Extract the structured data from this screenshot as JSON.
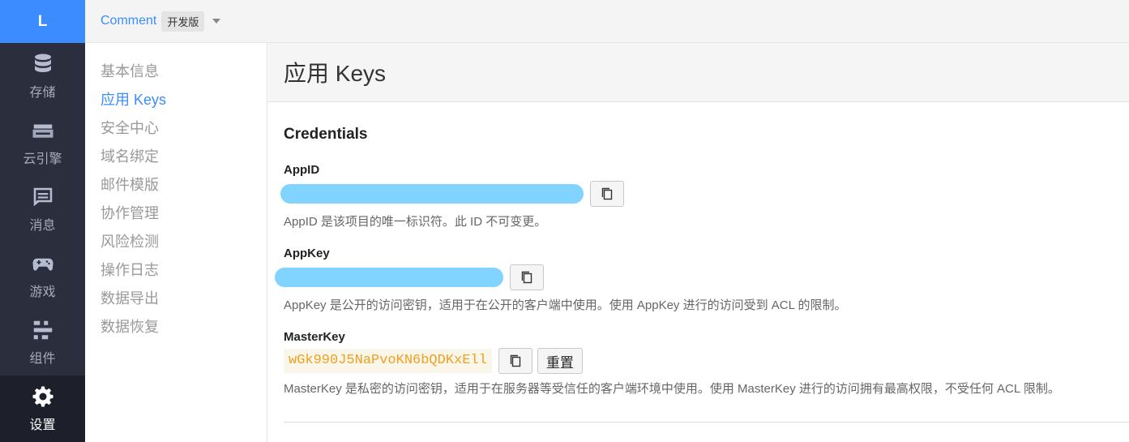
{
  "rail": {
    "logo": "L",
    "items": [
      {
        "label": "存储",
        "icon": "database-icon"
      },
      {
        "label": "云引擎",
        "icon": "cloud-engine-icon"
      },
      {
        "label": "消息",
        "icon": "message-icon"
      },
      {
        "label": "游戏",
        "icon": "gamepad-icon"
      },
      {
        "label": "组件",
        "icon": "components-icon"
      },
      {
        "label": "设置",
        "icon": "gear-icon",
        "active": true
      }
    ]
  },
  "topbar": {
    "app_name": "Comment",
    "env_badge": "开发版"
  },
  "subnav": {
    "items": [
      "基本信息",
      "应用 Keys",
      "安全中心",
      "域名绑定",
      "邮件模版",
      "协作管理",
      "风险检测",
      "操作日志",
      "数据导出",
      "数据恢复"
    ],
    "active_index": 1
  },
  "page": {
    "title": "应用 Keys",
    "section_title": "Credentials",
    "appid": {
      "label": "AppID",
      "help": "AppID 是该项目的唯一标识符。此 ID 不可变更。"
    },
    "appkey": {
      "label": "AppKey",
      "help": "AppKey 是公开的访问密钥，适用于在公开的客户端中使用。使用 AppKey 进行的访问受到 ACL 的限制。"
    },
    "masterkey": {
      "label": "MasterKey",
      "value": "wGk990J5NaPvoKN6bQDKxEll",
      "reset_label": "重置",
      "help": "MasterKey 是私密的访问密钥，适用于在服务器等受信任的客户端环境中使用。使用 MasterKey 进行的访问拥有最高权限，不受任何 ACL 限制。"
    }
  },
  "colors": {
    "accent": "#3c8cff",
    "rail_bg": "#2b2f3d",
    "mask": "#80d4ff",
    "masterkey_text": "#f0a020"
  }
}
